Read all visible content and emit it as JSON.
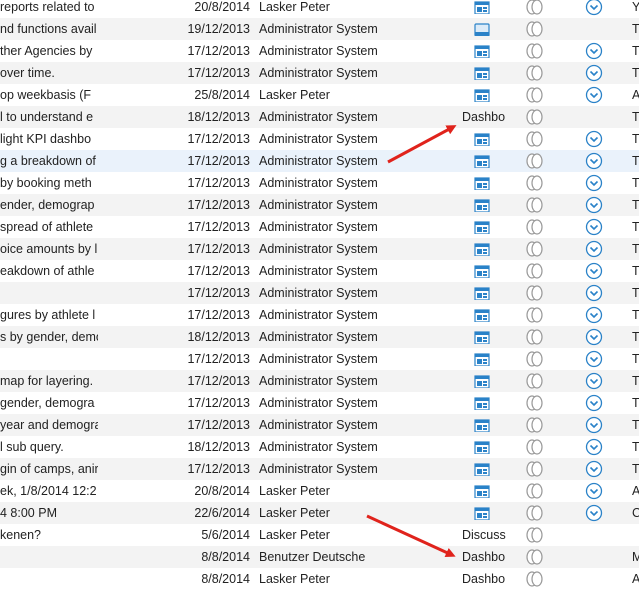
{
  "colors": {
    "accent": "#2a82c8",
    "arrow": "#e0231c",
    "alt_row": "#f3f3f3",
    "selected_row": "#eaf2fb"
  },
  "icons": {
    "dashboard": "dashboard-icon",
    "favorite": "favorite-toggle-icon",
    "chevron": "chevron-down-icon"
  },
  "rows": [
    {
      "desc": "reports related to",
      "date": "20/8/2014",
      "owner": "Lasker Peter",
      "type": "",
      "icon": "dash",
      "chev": true,
      "last": "Y"
    },
    {
      "desc": "nd functions avail",
      "date": "19/12/2013",
      "owner": "Administrator System",
      "type": "",
      "icon": "window",
      "chev": false,
      "last": "T"
    },
    {
      "desc": "ther Agencies by",
      "date": "17/12/2013",
      "owner": "Administrator System",
      "type": "",
      "icon": "dash",
      "chev": true,
      "last": "T"
    },
    {
      "desc": "over time.",
      "date": "17/12/2013",
      "owner": "Administrator System",
      "type": "",
      "icon": "dash",
      "chev": true,
      "last": "T"
    },
    {
      "desc": "op weekbasis (F",
      "date": "25/8/2014",
      "owner": "Lasker Peter",
      "type": "",
      "icon": "dash",
      "chev": true,
      "last": "A"
    },
    {
      "desc": "l to understand e",
      "date": "18/12/2013",
      "owner": "Administrator System",
      "type": "Dashbo",
      "icon": "none",
      "chev": false,
      "last": "T"
    },
    {
      "desc": "light KPI dashbo",
      "date": "17/12/2013",
      "owner": "Administrator System",
      "type": "",
      "icon": "dash",
      "chev": true,
      "last": "T"
    },
    {
      "desc": "g a breakdown of",
      "date": "17/12/2013",
      "owner": "Administrator System",
      "type": "",
      "icon": "dash",
      "chev": true,
      "last": "T"
    },
    {
      "desc": "by booking meth",
      "date": "17/12/2013",
      "owner": "Administrator System",
      "type": "",
      "icon": "dash",
      "chev": true,
      "last": "T"
    },
    {
      "desc": "ender, demograp",
      "date": "17/12/2013",
      "owner": "Administrator System",
      "type": "",
      "icon": "dash",
      "chev": true,
      "last": "T"
    },
    {
      "desc": "spread of athlete",
      "date": "17/12/2013",
      "owner": "Administrator System",
      "type": "",
      "icon": "dash",
      "chev": true,
      "last": "T"
    },
    {
      "desc": "oice amounts by l",
      "date": "17/12/2013",
      "owner": "Administrator System",
      "type": "",
      "icon": "dash",
      "chev": true,
      "last": "T"
    },
    {
      "desc": "eakdown of athle",
      "date": "17/12/2013",
      "owner": "Administrator System",
      "type": "",
      "icon": "dash",
      "chev": true,
      "last": "T"
    },
    {
      "desc": "",
      "date": "17/12/2013",
      "owner": "Administrator System",
      "type": "",
      "icon": "dash",
      "chev": true,
      "last": "T"
    },
    {
      "desc": "gures by athlete l",
      "date": "17/12/2013",
      "owner": "Administrator System",
      "type": "",
      "icon": "dash",
      "chev": true,
      "last": "T"
    },
    {
      "desc": "s by gender, demo",
      "date": "18/12/2013",
      "owner": "Administrator System",
      "type": "",
      "icon": "dash",
      "chev": true,
      "last": "T"
    },
    {
      "desc": "",
      "date": "17/12/2013",
      "owner": "Administrator System",
      "type": "",
      "icon": "dash",
      "chev": true,
      "last": "T"
    },
    {
      "desc": "map for layering.",
      "date": "17/12/2013",
      "owner": "Administrator System",
      "type": "",
      "icon": "dash",
      "chev": true,
      "last": "T"
    },
    {
      "desc": "gender, demogra",
      "date": "17/12/2013",
      "owner": "Administrator System",
      "type": "",
      "icon": "dash",
      "chev": true,
      "last": "T"
    },
    {
      "desc": "year and demogra",
      "date": "17/12/2013",
      "owner": "Administrator System",
      "type": "",
      "icon": "dash",
      "chev": true,
      "last": "T"
    },
    {
      "desc": "l sub query.",
      "date": "18/12/2013",
      "owner": "Administrator System",
      "type": "",
      "icon": "dash",
      "chev": true,
      "last": "T"
    },
    {
      "desc": "gin of camps, anir",
      "date": "17/12/2013",
      "owner": "Administrator System",
      "type": "",
      "icon": "dash",
      "chev": true,
      "last": "T"
    },
    {
      "desc": "ek, 1/8/2014 12:2",
      "date": "20/8/2014",
      "owner": "Lasker Peter",
      "type": "",
      "icon": "dash",
      "chev": true,
      "last": "A"
    },
    {
      "desc": "4 8:00 PM",
      "date": "22/6/2014",
      "owner": "Lasker Peter",
      "type": "",
      "icon": "dash",
      "chev": true,
      "last": "C"
    },
    {
      "desc": "kenen?",
      "date": "5/6/2014",
      "owner": "Lasker Peter",
      "type": "Discuss",
      "icon": "none",
      "chev": false,
      "last": ""
    },
    {
      "desc": "",
      "date": "8/8/2014",
      "owner": "Benutzer Deutsche",
      "type": "Dashbo",
      "icon": "none",
      "chev": false,
      "last": "M"
    },
    {
      "desc": "",
      "date": "8/8/2014",
      "owner": "Lasker Peter",
      "type": "Dashbo",
      "icon": "none",
      "chev": false,
      "last": "A"
    }
  ]
}
